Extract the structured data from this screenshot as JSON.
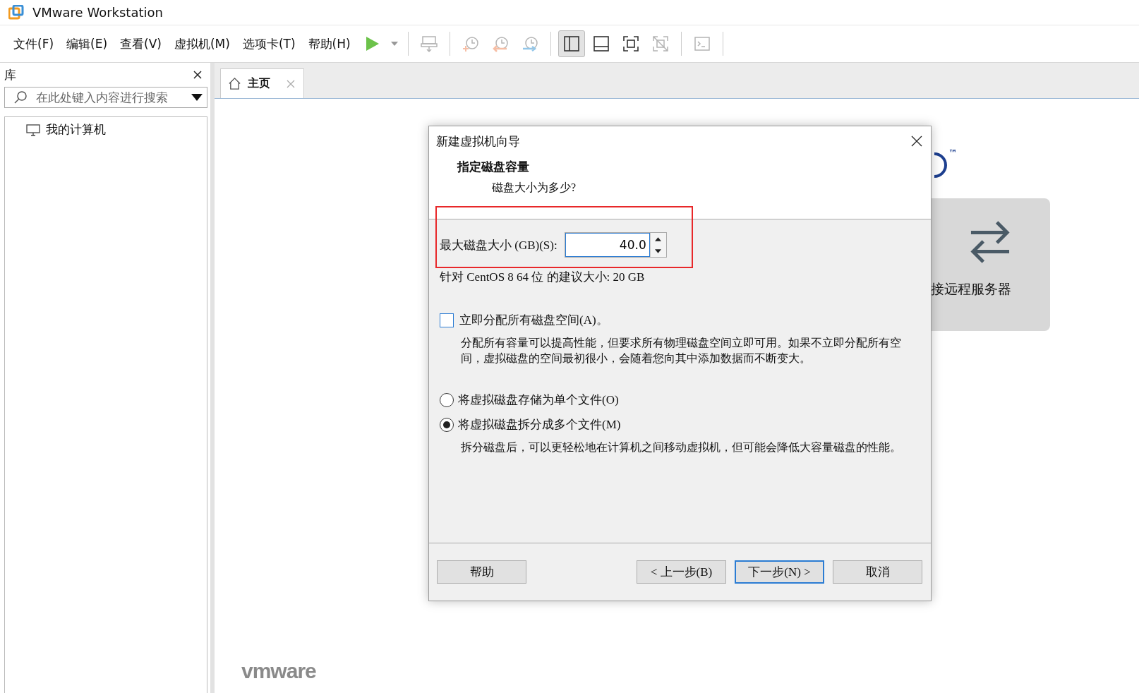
{
  "window": {
    "title": "VMware Workstation"
  },
  "menu": [
    "文件(F)",
    "编辑(E)",
    "查看(V)",
    "虚拟机(M)",
    "选项卡(T)",
    "帮助(H)"
  ],
  "toolbar": [
    {
      "kind": "play",
      "selected": false,
      "disabled": false
    },
    {
      "kind": "caret",
      "selected": false,
      "disabled": false
    },
    {
      "kind": "sep"
    },
    {
      "kind": "send-keys",
      "selected": false,
      "disabled": true
    },
    {
      "kind": "sep"
    },
    {
      "kind": "snapshot",
      "selected": false,
      "disabled": true
    },
    {
      "kind": "revert",
      "selected": false,
      "disabled": true
    },
    {
      "kind": "manage",
      "selected": false,
      "disabled": true
    },
    {
      "kind": "sep"
    },
    {
      "kind": "library",
      "selected": true,
      "disabled": false
    },
    {
      "kind": "thumbs",
      "selected": false,
      "disabled": false
    },
    {
      "kind": "fullscreen",
      "selected": false,
      "disabled": false
    },
    {
      "kind": "unity",
      "selected": false,
      "disabled": true
    },
    {
      "kind": "sep"
    },
    {
      "kind": "console",
      "selected": false,
      "disabled": true
    }
  ],
  "sidebar": {
    "title": "库",
    "search": {
      "placeholder": "在此处键入内容进行搜索"
    },
    "items": [
      {
        "label": "我的计算机",
        "selected": false
      }
    ]
  },
  "tabs": [
    {
      "label": "主页",
      "selected": true
    }
  ],
  "home": {
    "trademark": "™",
    "card_label": "接远程服务器",
    "logo": "vmware"
  },
  "dialog": {
    "title": "新建虚拟机向导",
    "heading": "指定磁盘容量",
    "subheading": "磁盘大小为多少?",
    "size_label": "最大磁盘大小 (GB)(S):",
    "size_value": "40.0",
    "highlighted": true,
    "recommend": "针对 CentOS 8 64 位 的建议大小: 20 GB",
    "allocate": {
      "label": "立即分配所有磁盘空间(A)。",
      "checked": false,
      "note": "分配所有容量可以提高性能，但要求所有物理磁盘空间立即可用。如果不立即分配所有空间，虚拟磁盘的空间最初很小，会随着您向其中添加数据而不断变大。"
    },
    "options": [
      {
        "label": "将虚拟磁盘存储为单个文件(O)",
        "selected": false
      },
      {
        "label": "将虚拟磁盘拆分成多个文件(M)",
        "selected": true,
        "note": "拆分磁盘后，可以更轻松地在计算机之间移动虚拟机，但可能会降低大容量磁盘的性能。"
      }
    ],
    "buttons": [
      {
        "label": "帮助",
        "kind": "help",
        "focused": false
      },
      {
        "label": "< 上一步(B)",
        "kind": "nav",
        "focused": false
      },
      {
        "label": "下一步(N) >",
        "kind": "nav",
        "focused": true
      },
      {
        "label": "取消",
        "kind": "cancel",
        "focused": false
      }
    ]
  }
}
